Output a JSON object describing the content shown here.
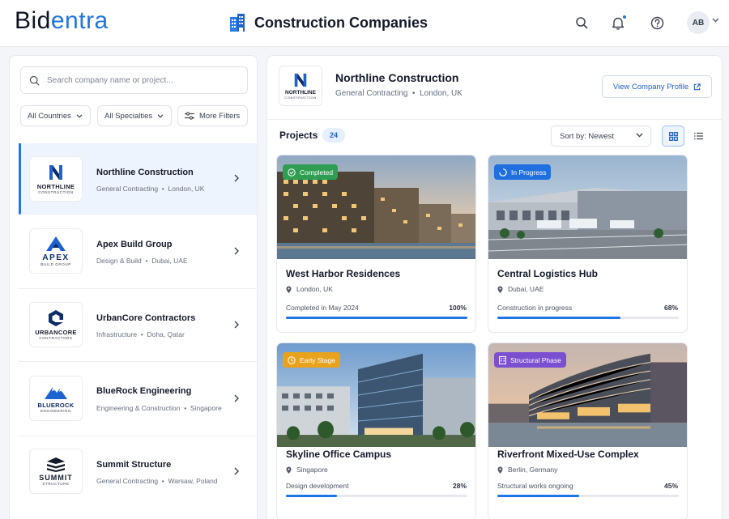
{
  "app": {
    "logo_left": "Bid",
    "logo_right": "entra"
  },
  "header": {
    "title": "Construction Companies",
    "avatar_initials": "AB"
  },
  "sidebar": {
    "search_placeholder": "Search company name or project...",
    "filters": [
      "All Countries",
      "All Specialties",
      "More Filters"
    ],
    "companies": [
      {
        "name": "Northline Construction",
        "specialty": "General Contracting",
        "location": "London, UK",
        "logo_text": "NORTHLINE",
        "logo_sub": "CONSTRUCTION"
      },
      {
        "name": "Apex Build Group",
        "specialty": "Design & Build",
        "location": "Dubai, UAE",
        "logo_text": "APEX",
        "logo_sub": "BUILD GROUP"
      },
      {
        "name": "UrbanCore Contractors",
        "specialty": "Infrastructure",
        "location": "Doha, Qatar",
        "logo_text": "URBANCORE",
        "logo_sub": "CONTRACTORS"
      },
      {
        "name": "BlueRock Engineering",
        "specialty": "Engineering & Construction",
        "location": "Singapore",
        "logo_text": "BLUEROCK",
        "logo_sub": "ENGINEERING"
      },
      {
        "name": "Summit Structure",
        "specialty": "General Contracting",
        "location": "Warsaw, Poland",
        "logo_text": "SUMMIT",
        "logo_sub": "STRUCTURE"
      }
    ]
  },
  "selected": {
    "name": "Northline Construction",
    "specialty": "General Contracting",
    "location": "London, UK",
    "logo_text": "NORTHLINE",
    "logo_sub": "CONSTRUCTION",
    "view_profile_label": "View Company Profile"
  },
  "projects": {
    "title": "Projects",
    "count": "24",
    "sort_label": "Sort by:",
    "sort_value": "Newest",
    "items": [
      {
        "title": "West Harbor Residences",
        "location": "London, UK",
        "status_badge": "Completed",
        "badge_color": "#2f9e52",
        "status_text": "Completed in May 2024",
        "progress_label": "100%",
        "progress": 1.0
      },
      {
        "title": "Central Logistics Hub",
        "location": "Dubai, UAE",
        "status_badge": "In Progress",
        "badge_color": "#1f6fe0",
        "status_text": "Construction in progress",
        "progress_label": "68%",
        "progress": 0.68
      },
      {
        "title": "Skyline Office Campus",
        "location": "Singapore",
        "status_badge": "Early Stage",
        "badge_color": "#e8a21b",
        "status_text": "Design development",
        "progress_label": "28%",
        "progress": 0.28
      },
      {
        "title": "Riverfront Mixed-Use Complex",
        "location": "Berlin, Germany",
        "status_badge": "Structural Phase",
        "badge_color": "#7a4fd0",
        "status_text": "Structural works ongoing",
        "progress_label": "45%",
        "progress": 0.45
      }
    ]
  },
  "colors": {
    "accent": "#1f74e6",
    "active_bg": "#eef4fd"
  }
}
